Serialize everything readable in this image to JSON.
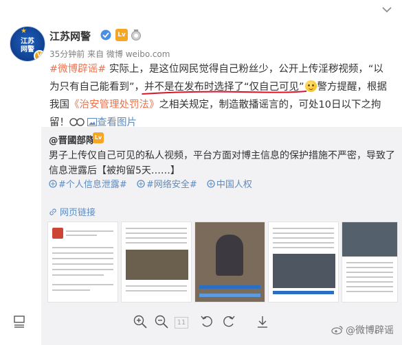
{
  "post": {
    "author": "江苏网警",
    "avatar_text": "江苏\n网警",
    "level_badge": "Lv",
    "meta_time": "35分钟前",
    "meta_from": "来自 微博 weibo.com",
    "hashtag": "#微博辟谣#",
    "text_part1": " 实际上，是这位网民觉得自己粉丝少，公开上传淫秽视频，“以为只有自己能看到”，",
    "text_underlined": "并不是在发布时选择了“仅自己可见”",
    "text_part2": "警方提醒，根据我国",
    "law_link": "《治安管理处罚法》",
    "text_part3": "之相关规定，制造散播谣言的，可处10日以下之拘留！",
    "view_images": "查看图片"
  },
  "repost": {
    "author": "@晋國部隊",
    "text": "男子上传仅自己可见的私人视频，平台方面对博主信息的保护措施不严密，导致了信息泄露后【被拘留5天……】",
    "topics": [
      "#个人信息泄露#",
      "#网络安全#",
      "中国人权"
    ],
    "web_link": "网页链接"
  },
  "toolbar": {
    "page_number": "11"
  },
  "watermark": {
    "text": "@微博辟谣"
  },
  "colors": {
    "accent_orange": "#eb7350",
    "link_blue": "#5d8bbf",
    "underline_red": "#d8142a",
    "repost_bg": "#f2f2f5"
  }
}
